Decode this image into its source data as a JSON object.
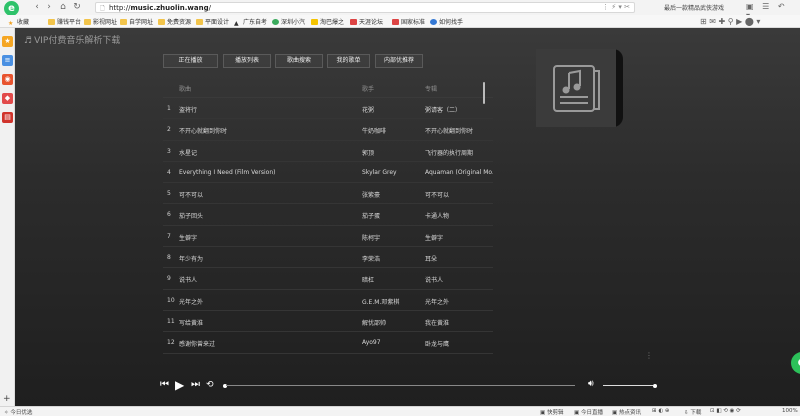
{
  "browser": {
    "url_prefix": "http://",
    "url_host": "music.zhuolin.wang",
    "url_suffix": "/",
    "search_hint": "最后一款精品武侠游戏",
    "bookmarks": [
      "收藏",
      "赚钱平台",
      "影视网址",
      "自学网址",
      "免费资源",
      "平面设计",
      "广东自考",
      "深圳小汽",
      "淘巴爆之",
      "天涯论坛",
      "国家标准",
      "如何找手"
    ],
    "status_left": "今日优选",
    "status_right": [
      "快剪辑",
      "今日直播",
      "热点资讯",
      "下载",
      "100%"
    ]
  },
  "app": {
    "title": "VIP付费音乐解析下载",
    "tabs": [
      "正在播放",
      "播放列表",
      "歌曲搜索",
      "我的歌单",
      "内部优推荐"
    ],
    "columns": {
      "song": "歌曲",
      "singer": "歌手",
      "album": "专辑"
    },
    "songs": [
      {
        "idx": "1",
        "song": "盗将行",
        "singer": "花粥",
        "album": "粥请客（二）"
      },
      {
        "idx": "2",
        "song": "不开心就翻到你时",
        "singer": "牛奶咖啡",
        "album": "不开心就翻到你时"
      },
      {
        "idx": "3",
        "song": "水星记",
        "singer": "郭顶",
        "album": "飞行器的执行周期"
      },
      {
        "idx": "4",
        "song": "Everything I Need (Film Version)",
        "singer": "Skylar Grey",
        "album": "Aquaman (Original Mo..."
      },
      {
        "idx": "5",
        "song": "可不可以",
        "singer": "张紫豪",
        "album": "可不可以"
      },
      {
        "idx": "6",
        "song": "茄子回头",
        "singer": "茄子蛋",
        "album": "卡通人物"
      },
      {
        "idx": "7",
        "song": "生僻字",
        "singer": "陈柯宇",
        "album": "生僻字"
      },
      {
        "idx": "8",
        "song": "年少有为",
        "singer": "李荣浩",
        "album": "耳朵"
      },
      {
        "idx": "9",
        "song": "说书人",
        "singer": "暗杠",
        "album": "说书人"
      },
      {
        "idx": "10",
        "song": "光年之外",
        "singer": "G.E.M.邓紫棋",
        "album": "光年之外"
      },
      {
        "idx": "11",
        "song": "写给黄淮",
        "singer": "解忧邵帅",
        "album": "我在黄淮"
      },
      {
        "idx": "12",
        "song": "感谢你曾来过",
        "singer": "Ayo97",
        "album": "卧龙与鹰"
      }
    ]
  }
}
